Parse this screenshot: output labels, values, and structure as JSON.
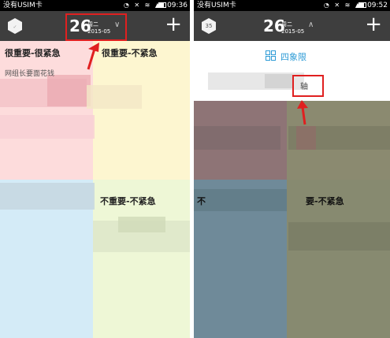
{
  "status_left": {
    "carrier": "没有USIM卡",
    "time": "09:36",
    "battery_level": 0.8
  },
  "status_right": {
    "carrier": "没有USIM卡",
    "time": "09:52",
    "battery_level": 0.8
  },
  "left_header": {
    "day": "26",
    "weekday": "周二",
    "year_month": "2015-05",
    "chevron": "chevron-down-icon",
    "add": "+"
  },
  "right_header": {
    "badge": "35",
    "day": "26",
    "weekday": "周二",
    "year_month": "2015-05",
    "chevron": "chevron-up-icon",
    "add": "+"
  },
  "left_quadrants": {
    "q1": "很重要-很紧急",
    "q1_item": "网组长要面花钱",
    "q2": "很重要-不紧急",
    "q4": "不重要-不紧急"
  },
  "right_menu": {
    "four_quadrant": "四象限",
    "axis_partial": "轴"
  },
  "right_quadrants": {
    "q3_partial": "不",
    "q4_partial": "要-不紧急"
  },
  "colors": {
    "q1_pink": "#fddcdc",
    "q2_yellow": "#fdf6d0",
    "q3_blue": "#d4ebf7",
    "q4_green": "#eef7d6",
    "dim_red": "#8e7476",
    "dim_olive": "#8b8a70",
    "dim_blue": "#6f8a99",
    "dim_green": "#878a70",
    "highlight": "#e02020",
    "accent": "#2d9bd6"
  }
}
